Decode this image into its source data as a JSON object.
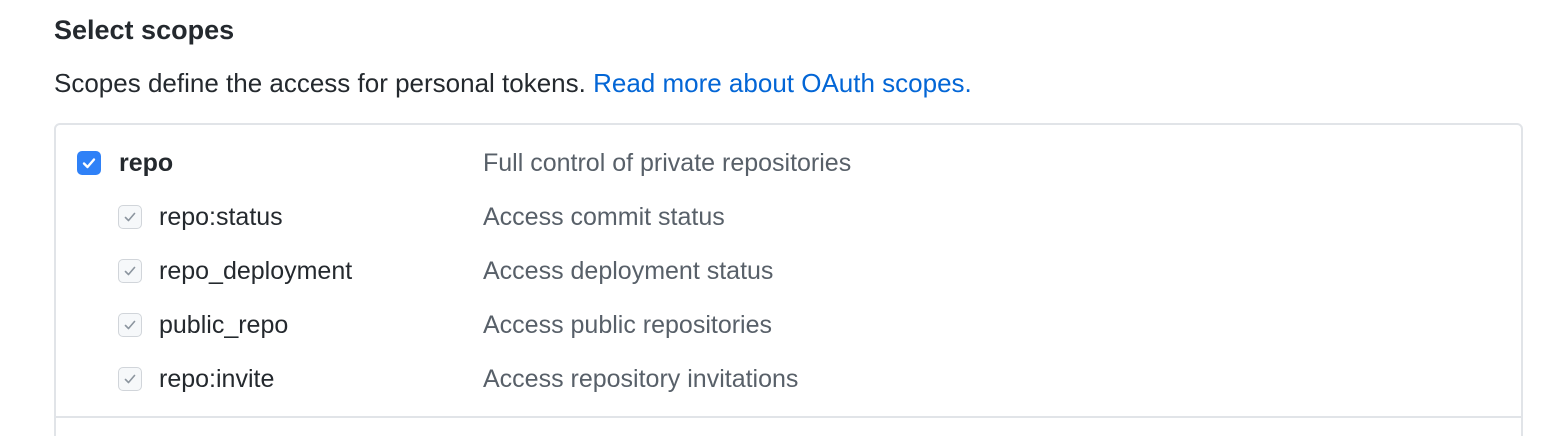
{
  "section": {
    "title": "Select scopes",
    "description": "Scopes define the access for personal tokens. ",
    "link_text": "Read more about OAuth scopes."
  },
  "scopes": {
    "repo": {
      "name": "repo",
      "description": "Full control of private repositories",
      "checked": true
    },
    "children": [
      {
        "name": "repo:status",
        "description": "Access commit status",
        "checked": true
      },
      {
        "name": "repo_deployment",
        "description": "Access deployment status",
        "checked": true
      },
      {
        "name": "public_repo",
        "description": "Access public repositories",
        "checked": true
      },
      {
        "name": "repo:invite",
        "description": "Access repository invitations",
        "checked": true
      }
    ]
  },
  "colors": {
    "accent": "#2f81f7",
    "link": "#0366d6",
    "border": "#e1e4e8",
    "muted_text": "#586069"
  },
  "icons": {
    "checked": "check-icon"
  }
}
